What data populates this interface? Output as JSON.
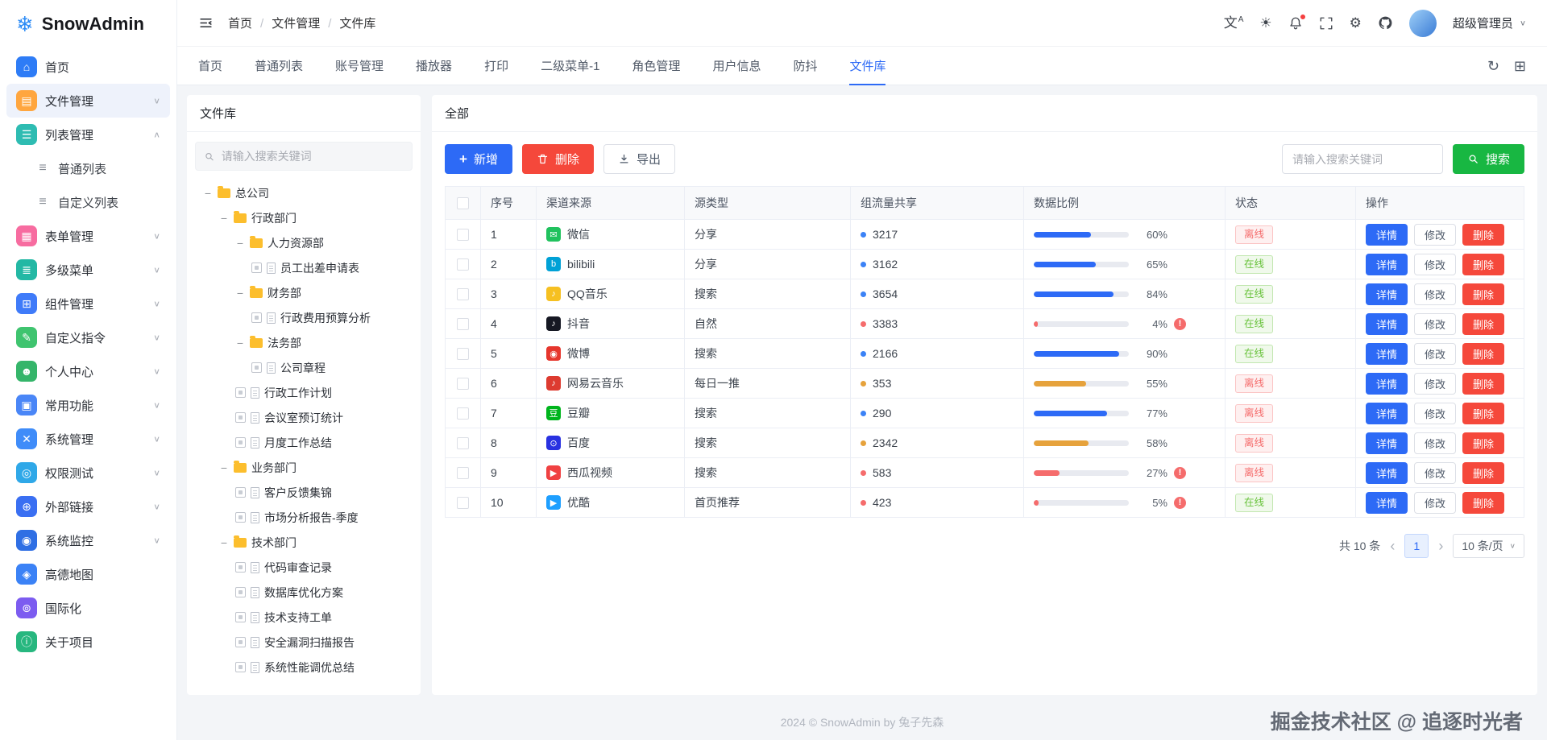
{
  "colors": {
    "primary": "#2d6af6",
    "danger": "#f5483b",
    "success": "#18b742",
    "warning": "#e6a23c",
    "online": "#67c23a",
    "offline": "#f56c6c"
  },
  "icons": {
    "snowflake": "❄",
    "translate": "文",
    "translate_sub": "A",
    "theme": "☀",
    "gear": "⚙",
    "refresh": "↻",
    "grid": "⊞",
    "chevron_down": "∨",
    "prev": "‹",
    "next": "›",
    "plus": "+",
    "warn": "!",
    "folder_collapse": "−"
  },
  "app": {
    "logo_text": "SnowAdmin"
  },
  "sidebar": {
    "items": [
      {
        "label": "首页",
        "icon": "home-icon",
        "glyph": "⌂",
        "bg": "#2e7cf6",
        "chevron": ""
      },
      {
        "label": "文件管理",
        "icon": "file-management-icon",
        "glyph": "▤",
        "bg": "#ffa63f",
        "chevron": "∨",
        "active": true
      },
      {
        "label": "列表管理",
        "icon": "list-management-icon",
        "glyph": "☰",
        "bg": "#2ebcb2",
        "chevron": "∧"
      },
      {
        "label": "普通列表",
        "icon": "plain-list-icon",
        "glyph": "≡",
        "bg": "",
        "chevron": "",
        "sub": true
      },
      {
        "label": "自定义列表",
        "icon": "custom-list-icon",
        "glyph": "≡",
        "bg": "",
        "chevron": "",
        "sub": true
      },
      {
        "label": "表单管理",
        "icon": "form-management-icon",
        "glyph": "▦",
        "bg": "#f76ca0",
        "chevron": "∨"
      },
      {
        "label": "多级菜单",
        "icon": "multilevel-menu-icon",
        "glyph": "≣",
        "bg": "#23b8a4",
        "chevron": "∨"
      },
      {
        "label": "组件管理",
        "icon": "component-management-icon",
        "glyph": "⊞",
        "bg": "#3f7bf9",
        "chevron": "∨"
      },
      {
        "label": "自定义指令",
        "icon": "custom-directives-icon",
        "glyph": "✎",
        "bg": "#3fc46f",
        "chevron": "∨"
      },
      {
        "label": "个人中心",
        "icon": "profile-icon",
        "glyph": "☻",
        "bg": "#35b56a",
        "chevron": "∨"
      },
      {
        "label": "常用功能",
        "icon": "common-functions-icon",
        "glyph": "▣",
        "bg": "#4a86f7",
        "chevron": "∨"
      },
      {
        "label": "系统管理",
        "icon": "system-management-icon",
        "glyph": "✕",
        "bg": "#3f8cf9",
        "chevron": "∨"
      },
      {
        "label": "权限测试",
        "icon": "permission-test-icon",
        "glyph": "◎",
        "bg": "#2fa8e8",
        "chevron": "∨"
      },
      {
        "label": "外部链接",
        "icon": "external-link-icon",
        "glyph": "⊕",
        "bg": "#3a6ff2",
        "chevron": "∨"
      },
      {
        "label": "系统监控",
        "icon": "system-monitor-icon",
        "glyph": "◉",
        "bg": "#2f6fe4",
        "chevron": "∨"
      },
      {
        "label": "高德地图",
        "icon": "amap-icon",
        "glyph": "◈",
        "bg": "#3b82f6",
        "chevron": ""
      },
      {
        "label": "国际化",
        "icon": "i18n-icon",
        "glyph": "⊚",
        "bg": "#7c5cf0",
        "chevron": ""
      },
      {
        "label": "关于项目",
        "icon": "about-project-icon",
        "glyph": "ⓘ",
        "bg": "#27b77f",
        "chevron": ""
      }
    ]
  },
  "header": {
    "breadcrumb": [
      {
        "label": "首页"
      },
      {
        "label": "文件管理"
      },
      {
        "label": "文件库"
      }
    ],
    "user": "超级管理员"
  },
  "tabbar": {
    "tabs": [
      {
        "label": "首页"
      },
      {
        "label": "普通列表"
      },
      {
        "label": "账号管理"
      },
      {
        "label": "播放器"
      },
      {
        "label": "打印"
      },
      {
        "label": "二级菜单-1"
      },
      {
        "label": "角色管理"
      },
      {
        "label": "用户信息"
      },
      {
        "label": "防抖"
      },
      {
        "label": "文件库",
        "active": true
      }
    ]
  },
  "file_panel": {
    "title": "文件库",
    "search_placeholder": "请输入搜索关键词",
    "tree": [
      {
        "label": "总公司",
        "folder": true,
        "depth": 0
      },
      {
        "label": "行政部门",
        "folder": true,
        "depth": 1
      },
      {
        "label": "人力资源部",
        "folder": true,
        "depth": 2
      },
      {
        "label": "员工出差申请表",
        "folder": false,
        "depth": 3
      },
      {
        "label": "财务部",
        "folder": true,
        "depth": 2
      },
      {
        "label": "行政费用预算分析",
        "folder": false,
        "depth": 3
      },
      {
        "label": "法务部",
        "folder": true,
        "depth": 2
      },
      {
        "label": "公司章程",
        "folder": false,
        "depth": 3
      },
      {
        "label": "行政工作计划",
        "folder": false,
        "depth": 2
      },
      {
        "label": "会议室预订统计",
        "folder": false,
        "depth": 2
      },
      {
        "label": "月度工作总结",
        "folder": false,
        "depth": 2
      },
      {
        "label": "业务部门",
        "folder": true,
        "depth": 1
      },
      {
        "label": "客户反馈集锦",
        "folder": false,
        "depth": 2
      },
      {
        "label": "市场分析报告-季度",
        "folder": false,
        "depth": 2
      },
      {
        "label": "技术部门",
        "folder": true,
        "depth": 1
      },
      {
        "label": "代码审查记录",
        "folder": false,
        "depth": 2
      },
      {
        "label": "数据库优化方案",
        "folder": false,
        "depth": 2
      },
      {
        "label": "技术支持工单",
        "folder": false,
        "depth": 2
      },
      {
        "label": "安全漏洞扫描报告",
        "folder": false,
        "depth": 2
      },
      {
        "label": "系统性能调优总结",
        "folder": false,
        "depth": 2
      }
    ]
  },
  "table_panel": {
    "title": "全部",
    "toolbar": {
      "add": "新增",
      "delete": "删除",
      "export": "导出",
      "search_placeholder": "请输入搜索关键词",
      "search": "搜索"
    },
    "columns": [
      "序号",
      "渠道来源",
      "源类型",
      "组流量共享",
      "数据比例",
      "状态",
      "操作"
    ],
    "actions": {
      "detail": "详情",
      "edit": "修改",
      "del": "删除"
    },
    "rows": [
      {
        "no": "1",
        "channel": "微信",
        "icon": "wechat-icon",
        "icon_bg": "#21c25e",
        "icon_glyph": "✉",
        "type": "分享",
        "traffic": "3217",
        "dot_color": "#3b82f6",
        "percent": "60%",
        "bar_color": "#2d6af6",
        "warn": false,
        "status": "离线",
        "online": false
      },
      {
        "no": "2",
        "channel": "bilibili",
        "icon": "bilibili-icon",
        "icon_bg": "#00a1d6",
        "icon_glyph": "b",
        "type": "分享",
        "traffic": "3162",
        "dot_color": "#3b82f6",
        "percent": "65%",
        "bar_color": "#2d6af6",
        "warn": false,
        "status": "在线",
        "online": true
      },
      {
        "no": "3",
        "channel": "QQ音乐",
        "icon": "qq-music-icon",
        "icon_bg": "#f6c021",
        "icon_glyph": "♪",
        "type": "搜索",
        "traffic": "3654",
        "dot_color": "#3b82f6",
        "percent": "84%",
        "bar_color": "#2d6af6",
        "warn": false,
        "status": "在线",
        "online": true
      },
      {
        "no": "4",
        "channel": "抖音",
        "icon": "douyin-icon",
        "icon_bg": "#161823",
        "icon_glyph": "♪",
        "type": "自然",
        "traffic": "3383",
        "dot_color": "#f56c6c",
        "percent": "4%",
        "bar_color": "#f56c6c",
        "warn": true,
        "status": "在线",
        "online": true
      },
      {
        "no": "5",
        "channel": "微博",
        "icon": "weibo-icon",
        "icon_bg": "#e6362d",
        "icon_glyph": "◉",
        "type": "搜索",
        "traffic": "2166",
        "dot_color": "#3b82f6",
        "percent": "90%",
        "bar_color": "#2d6af6",
        "warn": false,
        "status": "在线",
        "online": true
      },
      {
        "no": "6",
        "channel": "网易云音乐",
        "icon": "netease-music-icon",
        "icon_bg": "#dd3b30",
        "icon_glyph": "♪",
        "type": "每日一推",
        "traffic": "353",
        "dot_color": "#e6a23c",
        "percent": "55%",
        "bar_color": "#e6a23c",
        "warn": false,
        "status": "离线",
        "online": false
      },
      {
        "no": "7",
        "channel": "豆瓣",
        "icon": "douban-icon",
        "icon_bg": "#00b51d",
        "icon_glyph": "豆",
        "type": "搜索",
        "traffic": "290",
        "dot_color": "#3b82f6",
        "percent": "77%",
        "bar_color": "#2d6af6",
        "warn": false,
        "status": "离线",
        "online": false
      },
      {
        "no": "8",
        "channel": "百度",
        "icon": "baidu-icon",
        "icon_bg": "#2932e1",
        "icon_glyph": "⊙",
        "type": "搜索",
        "traffic": "2342",
        "dot_color": "#e6a23c",
        "percent": "58%",
        "bar_color": "#e6a23c",
        "warn": false,
        "status": "离线",
        "online": false
      },
      {
        "no": "9",
        "channel": "西瓜视频",
        "icon": "xigua-video-icon",
        "icon_bg": "#f04142",
        "icon_glyph": "▶",
        "type": "搜索",
        "traffic": "583",
        "dot_color": "#f56c6c",
        "percent": "27%",
        "bar_color": "#f56c6c",
        "warn": true,
        "status": "离线",
        "online": false
      },
      {
        "no": "10",
        "channel": "优酷",
        "icon": "youku-icon",
        "icon_bg": "#1e9fff",
        "icon_glyph": "▶",
        "type": "首页推荐",
        "traffic": "423",
        "dot_color": "#f56c6c",
        "percent": "5%",
        "bar_color": "#f56c6c",
        "warn": true,
        "status": "在线",
        "online": true
      }
    ],
    "pagination": {
      "total": "共 10 条",
      "page": "1",
      "page_size": "10 条/页"
    }
  },
  "footer": {
    "text": "2024 © SnowAdmin by 兔子先森"
  },
  "watermark": {
    "text": "掘金技术社区 @ 追逐时光者"
  }
}
